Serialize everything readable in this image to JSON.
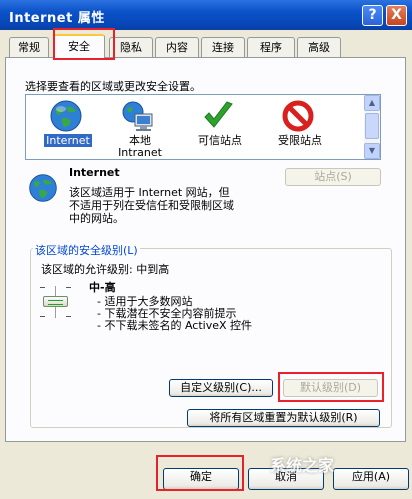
{
  "window": {
    "title": "Internet 属性",
    "help_label": "?",
    "close_label": "X"
  },
  "tabs": [
    {
      "label": "常规"
    },
    {
      "label": "安全"
    },
    {
      "label": "隐私"
    },
    {
      "label": "内容"
    },
    {
      "label": "连接"
    },
    {
      "label": "程序"
    },
    {
      "label": "高级"
    }
  ],
  "active_tab": "安全",
  "security": {
    "select_zone_prompt": "选择要查看的区域或更改安全设置。",
    "zones": [
      {
        "label": "Internet",
        "label2": "",
        "icon": "globe-icon",
        "selected": true
      },
      {
        "label": "本地",
        "label2": "Intranet",
        "icon": "local-intranet-icon",
        "selected": false
      },
      {
        "label": "可信站点",
        "label2": "",
        "icon": "checkmark-icon",
        "selected": false
      },
      {
        "label": "受限站点",
        "label2": "",
        "icon": "prohibited-icon",
        "selected": false
      }
    ],
    "zone_name": "Internet",
    "zone_description_1": "该区域适用于 Internet 网站，但",
    "zone_description_2": "不适用于列在受信任和受限制区域",
    "zone_description_3": "中的网站。",
    "sites_button": "站点(S)",
    "level_group_title": "该区域的安全级别(L)",
    "allowed_levels": "该区域的允许级别: 中到高",
    "level_name": "中-高",
    "level_bullets": [
      "- 适用于大多数网站",
      "- 下载潜在不安全内容前提示",
      "- 不下载未签名的 ActiveX 控件"
    ],
    "level_value": "medium-high",
    "custom_level_button": "自定义级别(C)...",
    "default_level_button": "默认级别(D)",
    "reset_all_button": "将所有区域重置为默认级别(R)"
  },
  "footer": {
    "ok_button": "确定",
    "cancel_button": "取消",
    "apply_button": "应用(A)"
  },
  "watermark": "系统之家",
  "colors": {
    "title_bar": "#0a52c8",
    "highlight_box": "#e8222a",
    "selection": "#316ac5",
    "group_title": "#0046d5"
  }
}
